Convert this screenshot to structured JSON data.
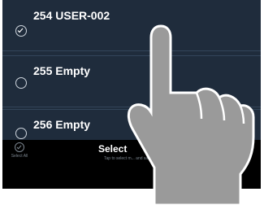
{
  "list": {
    "items": [
      {
        "label": "254 USER-002",
        "selected": true
      },
      {
        "label": "255 Empty",
        "selected": false
      },
      {
        "label": "256 Empty",
        "selected": false
      }
    ]
  },
  "bottom_bar": {
    "select_all_label": "Select All",
    "title": "Select",
    "hint": "Tap to select m... and save the..."
  },
  "colors": {
    "list_background": "#1f2c3c",
    "bar_background": "#000000",
    "hand_fill": "#9a9a9a"
  }
}
